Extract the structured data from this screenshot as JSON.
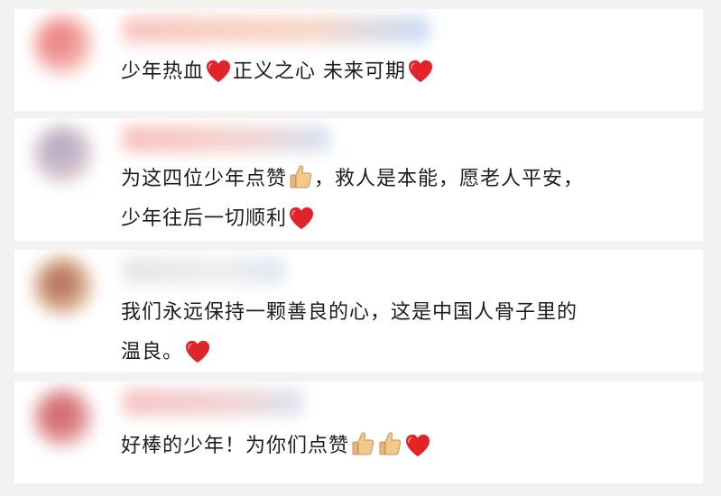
{
  "comments": [
    {
      "lines": [
        [
          {
            "t": "text",
            "v": "少年热血"
          },
          {
            "t": "emoji",
            "v": "heart"
          },
          {
            "t": "text",
            "v": "正义之心 未来可期"
          },
          {
            "t": "emoji",
            "v": "heart"
          }
        ]
      ]
    },
    {
      "lines": [
        [
          {
            "t": "text",
            "v": "为这四位少年点赞"
          },
          {
            "t": "emoji",
            "v": "thumbs-up"
          },
          {
            "t": "text",
            "v": "，救人是本能，愿老人平安，"
          }
        ],
        [
          {
            "t": "text",
            "v": "少年往后一切顺利"
          },
          {
            "t": "emoji",
            "v": "heart"
          }
        ]
      ]
    },
    {
      "lines": [
        [
          {
            "t": "text",
            "v": "我们永远保持一颗善良的心，这是中国人骨子里的"
          }
        ],
        [
          {
            "t": "text",
            "v": "温良。"
          },
          {
            "t": "emoji",
            "v": "heart"
          }
        ]
      ]
    },
    {
      "lines": [
        [
          {
            "t": "text",
            "v": "好棒的少年！为你们点赞"
          },
          {
            "t": "emoji",
            "v": "thumbs-up"
          },
          {
            "t": "emoji",
            "v": "thumbs-up"
          },
          {
            "t": "emoji",
            "v": "heart"
          }
        ]
      ]
    }
  ],
  "colors": {
    "page_background": "#f2f2f2",
    "card_background": "#ffffff",
    "text": "#1d1d1d",
    "heart": "#e0242a",
    "thumb": "#f3c88b"
  }
}
